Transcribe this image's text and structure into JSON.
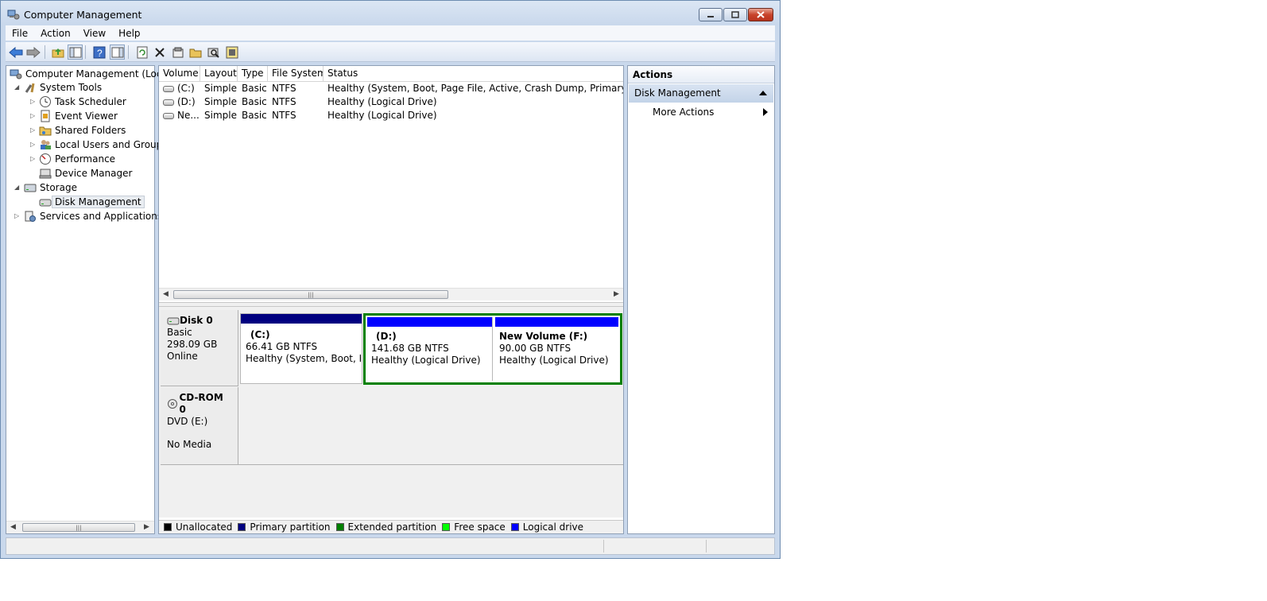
{
  "window": {
    "title": "Computer Management"
  },
  "menu": [
    "File",
    "Action",
    "View",
    "Help"
  ],
  "toolbar": {
    "icons": [
      "back-arrow-icon",
      "forward-arrow-icon",
      "up-folder-icon",
      "show-hide-tree-icon",
      "help-icon",
      "show-action-pane-icon",
      "refresh-icon",
      "delete-icon",
      "properties-icon",
      "open-folder-icon",
      "search-disk-icon",
      "settings-icon"
    ]
  },
  "tree": {
    "root": "Computer Management (Local",
    "system_tools": "System Tools",
    "task_scheduler": "Task Scheduler",
    "event_viewer": "Event Viewer",
    "shared_folders": "Shared Folders",
    "local_users": "Local Users and Groups",
    "performance": "Performance",
    "device_manager": "Device Manager",
    "storage": "Storage",
    "disk_management": "Disk Management",
    "services": "Services and Applications"
  },
  "volumes": {
    "columns": [
      "Volume",
      "Layout",
      "Type",
      "File System",
      "Status"
    ],
    "rows": [
      {
        "volume": "(C:)",
        "layout": "Simple",
        "type": "Basic",
        "fs": "NTFS",
        "status": "Healthy (System, Boot, Page File, Active, Crash Dump, Primary Partition"
      },
      {
        "volume": "(D:)",
        "layout": "Simple",
        "type": "Basic",
        "fs": "NTFS",
        "status": "Healthy (Logical Drive)"
      },
      {
        "volume": "Ne...",
        "layout": "Simple",
        "type": "Basic",
        "fs": "NTFS",
        "status": "Healthy (Logical Drive)"
      }
    ]
  },
  "disks": {
    "disk0": {
      "name": "Disk 0",
      "type": "Basic",
      "size": "298.09 GB",
      "state": "Online"
    },
    "cdrom0": {
      "name": "CD-ROM 0",
      "type": "DVD (E:)",
      "media": "No Media"
    },
    "partitions": [
      {
        "title": "(C:)",
        "size": "66.41 GB NTFS",
        "status": "Healthy (System, Boot, Pag"
      },
      {
        "title": "(D:)",
        "size": "141.68 GB NTFS",
        "status": "Healthy (Logical Drive)"
      },
      {
        "title": "New Volume  (F:)",
        "size": "90.00 GB NTFS",
        "status": "Healthy (Logical Drive)"
      }
    ]
  },
  "legend": [
    "Unallocated",
    "Primary partition",
    "Extended partition",
    "Free space",
    "Logical drive"
  ],
  "colors": {
    "unallocated": "#000000",
    "primary": "#000080",
    "extended": "#008000",
    "free": "#00ff00",
    "logical": "#0000ff"
  },
  "actions": {
    "title": "Actions",
    "section": "Disk Management",
    "more": "More Actions"
  }
}
